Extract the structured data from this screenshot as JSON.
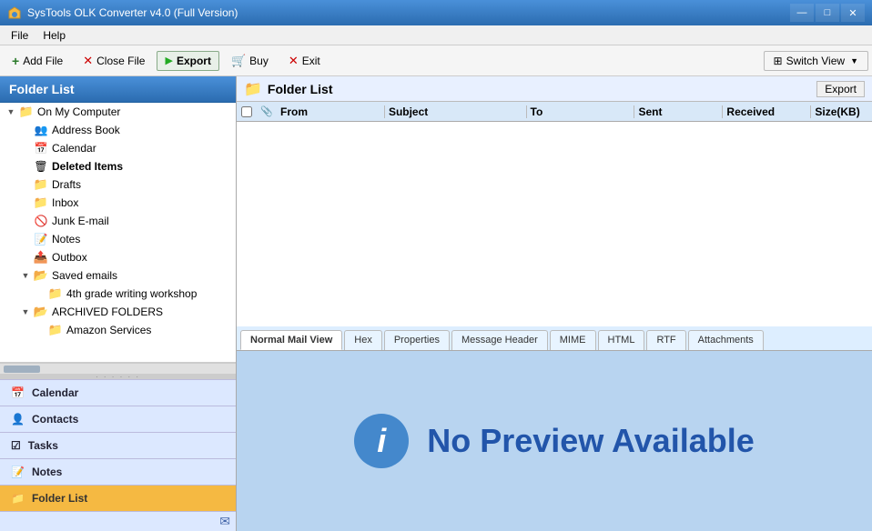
{
  "titleBar": {
    "title": "SysTools OLK Converter v4.0 (Full Version)",
    "controls": {
      "minimize": "—",
      "maximize": "□",
      "close": "✕"
    }
  },
  "menuBar": {
    "items": [
      "File",
      "Help"
    ]
  },
  "toolbar": {
    "addFile": "Add File",
    "closeFile": "Close File",
    "export": "Export",
    "buy": "Buy",
    "exit": "Exit",
    "switchView": "Switch View"
  },
  "leftPanel": {
    "header": "Folder List",
    "tree": {
      "items": [
        {
          "id": "onMyComputer",
          "label": "On My Computer",
          "indent": 0,
          "expanded": true,
          "type": "root"
        },
        {
          "id": "addressBook",
          "label": "Address Book",
          "indent": 1,
          "expanded": false,
          "type": "addressbook"
        },
        {
          "id": "calendar",
          "label": "Calendar",
          "indent": 1,
          "expanded": false,
          "type": "calendar"
        },
        {
          "id": "deletedItems",
          "label": "Deleted Items",
          "indent": 1,
          "expanded": false,
          "type": "deleted"
        },
        {
          "id": "drafts",
          "label": "Drafts",
          "indent": 1,
          "expanded": false,
          "type": "folder"
        },
        {
          "id": "inbox",
          "label": "Inbox",
          "indent": 1,
          "expanded": false,
          "type": "folder"
        },
        {
          "id": "junkEmail",
          "label": "Junk E-mail",
          "indent": 1,
          "expanded": false,
          "type": "junk"
        },
        {
          "id": "notes",
          "label": "Notes",
          "indent": 1,
          "expanded": false,
          "type": "notes"
        },
        {
          "id": "outbox",
          "label": "Outbox",
          "indent": 1,
          "expanded": false,
          "type": "folder"
        },
        {
          "id": "savedEmails",
          "label": "Saved emails",
          "indent": 1,
          "expanded": true,
          "type": "folder-open"
        },
        {
          "id": "gradingWorkshop",
          "label": "4th grade writing workshop",
          "indent": 2,
          "expanded": false,
          "type": "folder"
        },
        {
          "id": "archivedFolders",
          "label": "ARCHIVED FOLDERS",
          "indent": 1,
          "expanded": true,
          "type": "folder-open"
        },
        {
          "id": "amazonServices",
          "label": "Amazon Services",
          "indent": 2,
          "expanded": false,
          "type": "folder"
        }
      ]
    },
    "navButtons": [
      {
        "id": "calendar",
        "label": "Calendar",
        "icon": "📅"
      },
      {
        "id": "contacts",
        "label": "Contacts",
        "icon": "👤"
      },
      {
        "id": "tasks",
        "label": "Tasks",
        "icon": "☑"
      },
      {
        "id": "notes",
        "label": "Notes",
        "icon": "📝"
      },
      {
        "id": "folderList",
        "label": "Folder List",
        "icon": "📁",
        "active": true
      }
    ]
  },
  "rightPanel": {
    "header": "Folder List",
    "exportButton": "Export",
    "tableHeaders": {
      "from": "From",
      "subject": "Subject",
      "to": "To",
      "sent": "Sent",
      "received": "Received",
      "size": "Size(KB)"
    }
  },
  "previewTabs": {
    "tabs": [
      {
        "id": "normalMailView",
        "label": "Normal Mail View",
        "active": true
      },
      {
        "id": "hex",
        "label": "Hex"
      },
      {
        "id": "properties",
        "label": "Properties"
      },
      {
        "id": "messageHeader",
        "label": "Message Header"
      },
      {
        "id": "mime",
        "label": "MIME"
      },
      {
        "id": "html",
        "label": "HTML"
      },
      {
        "id": "rtf",
        "label": "RTF"
      },
      {
        "id": "attachments",
        "label": "Attachments"
      }
    ],
    "noPreview": "No Preview Available",
    "infoIcon": "i"
  }
}
